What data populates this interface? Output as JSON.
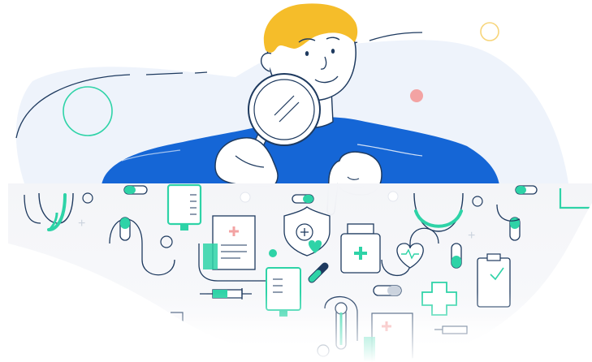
{
  "illustration": {
    "subject": "person-inspecting-medical-icons",
    "icons": [
      "stethoscope-icon",
      "iv-bag-icon",
      "medical-report-icon",
      "shield-plus-icon",
      "heart-icon",
      "medicine-bottle-icon",
      "heart-monitor-icon",
      "capsule-icon",
      "pill-icon",
      "syringe-icon",
      "thermometer-icon",
      "first-aid-cross-icon",
      "clipboard-icon",
      "magnifying-glass-icon"
    ]
  },
  "colors": {
    "blob": "#EEF3FB",
    "hair": "#F5BD2A",
    "shirt": "#1566D6",
    "outline": "#1E3A5F",
    "teal": "#2ED3A7",
    "coral": "#F3A3A3",
    "yellow_ring": "#F7D57A",
    "pattern_bg": "#F4F5F8"
  }
}
